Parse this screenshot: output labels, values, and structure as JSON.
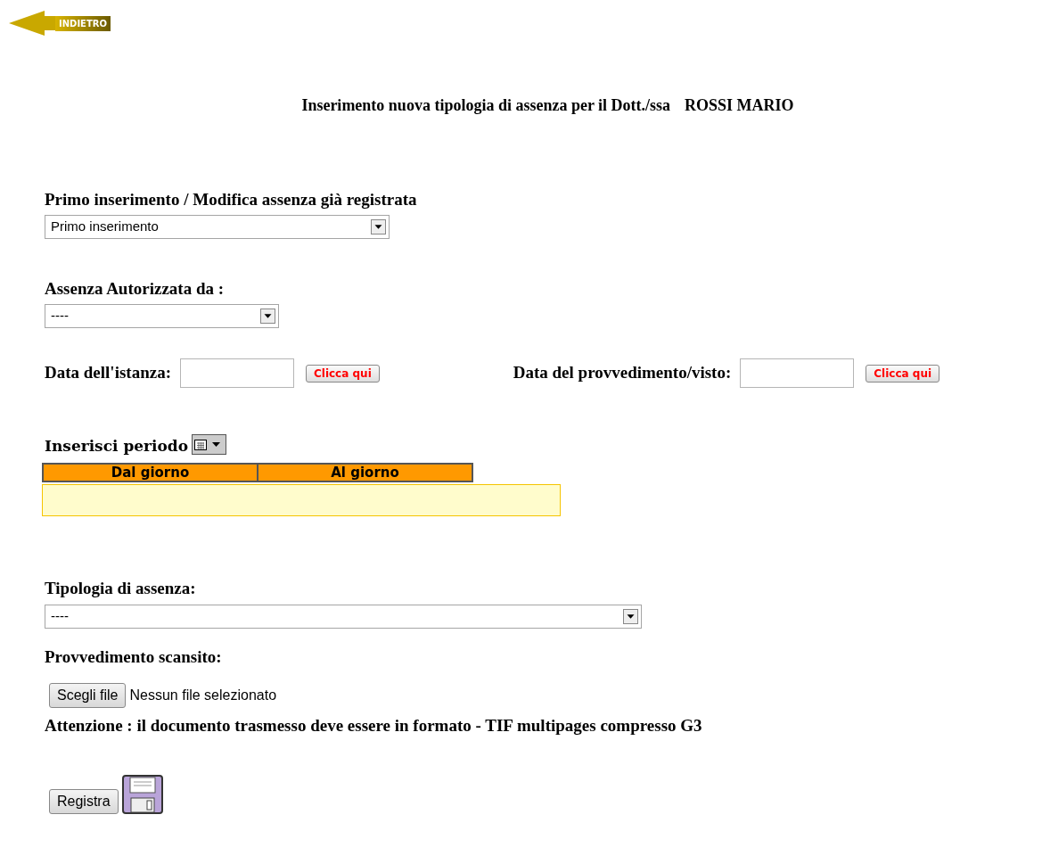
{
  "back_button": {
    "label": "INDIETRO"
  },
  "heading": {
    "text": "Inserimento nuova tipologia di assenza per il Dott./ssa",
    "person": "ROSSI MARIO"
  },
  "mode_select": {
    "label": "Primo inserimento / Modifica assenza già registrata",
    "value": "Primo inserimento"
  },
  "authorized_by": {
    "label": "Assenza Autorizzata da :",
    "value": "----"
  },
  "dates": [
    {
      "label": "Data dell'istanza:",
      "button": "Clicca qui"
    },
    {
      "label": "Data del provvedimento/visto:",
      "button": "Clicca qui"
    }
  ],
  "period": {
    "label": "Inserisci periodo",
    "columns": [
      "Dal giorno",
      "Al giorno"
    ]
  },
  "absence_type": {
    "label": "Tipologia di assenza:",
    "value": "----"
  },
  "scanned_document": {
    "label": "Provvedimento scansito:",
    "button": "Scegli file",
    "status": "Nessun file selezionato"
  },
  "notice": "Attenzione : il documento trasmesso deve essere in formato - TIF multipages compresso G3",
  "submit_button": {
    "label": "Registra"
  }
}
